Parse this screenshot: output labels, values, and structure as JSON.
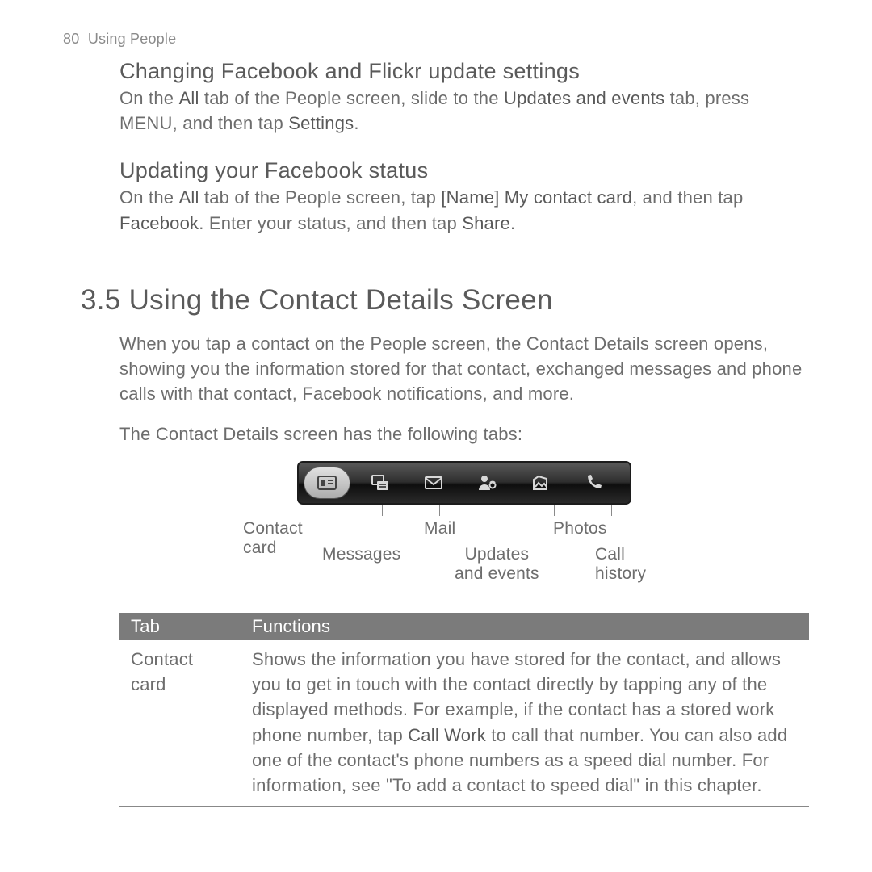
{
  "header": {
    "page_number": "80",
    "section": "Using People"
  },
  "section1": {
    "title": "Changing Facebook and Flickr update settings",
    "text_pre": "On the ",
    "b1": "All",
    "text_mid1": " tab of the People screen, slide to the ",
    "b2": "Updates and events",
    "text_mid2": " tab, press MENU, and then tap ",
    "b3": "Settings",
    "text_end": "."
  },
  "section2": {
    "title": "Updating your Facebook status",
    "t1": "On the ",
    "b1": "All",
    "t2": " tab of the People screen, tap ",
    "b2": "[Name] My contact card",
    "t3": ", and then tap ",
    "b3": "Facebook",
    "t4": ". Enter your status, and then tap ",
    "b4": "Share",
    "t5": "."
  },
  "main": {
    "title": "3.5  Using the Contact Details Screen",
    "p1": "When you tap a contact on the People screen, the Contact Details screen opens, showing you the information stored for that contact, exchanged messages and phone calls with that contact, Facebook notifications, and more.",
    "p2": "The Contact Details screen has the following tabs:"
  },
  "tabs": {
    "contact_card": "Contact\ncard",
    "messages": "Messages",
    "mail": "Mail",
    "updates": "Updates\nand events",
    "photos": "Photos",
    "call_history": "Call\nhistory"
  },
  "table": {
    "h1": "Tab",
    "h2": "Functions",
    "r1c1": "Contact card",
    "r1c2_a": "Shows the information you have stored for the contact, and allows you to get in touch with the contact directly by tapping any of the displayed methods. For example, if the contact has a stored work phone number, tap ",
    "r1c2_b": "Call Work",
    "r1c2_c": " to call that number. You can also add one of the contact's phone numbers as a speed dial number. For information, see \"To add a contact to speed dial\" in this chapter."
  }
}
